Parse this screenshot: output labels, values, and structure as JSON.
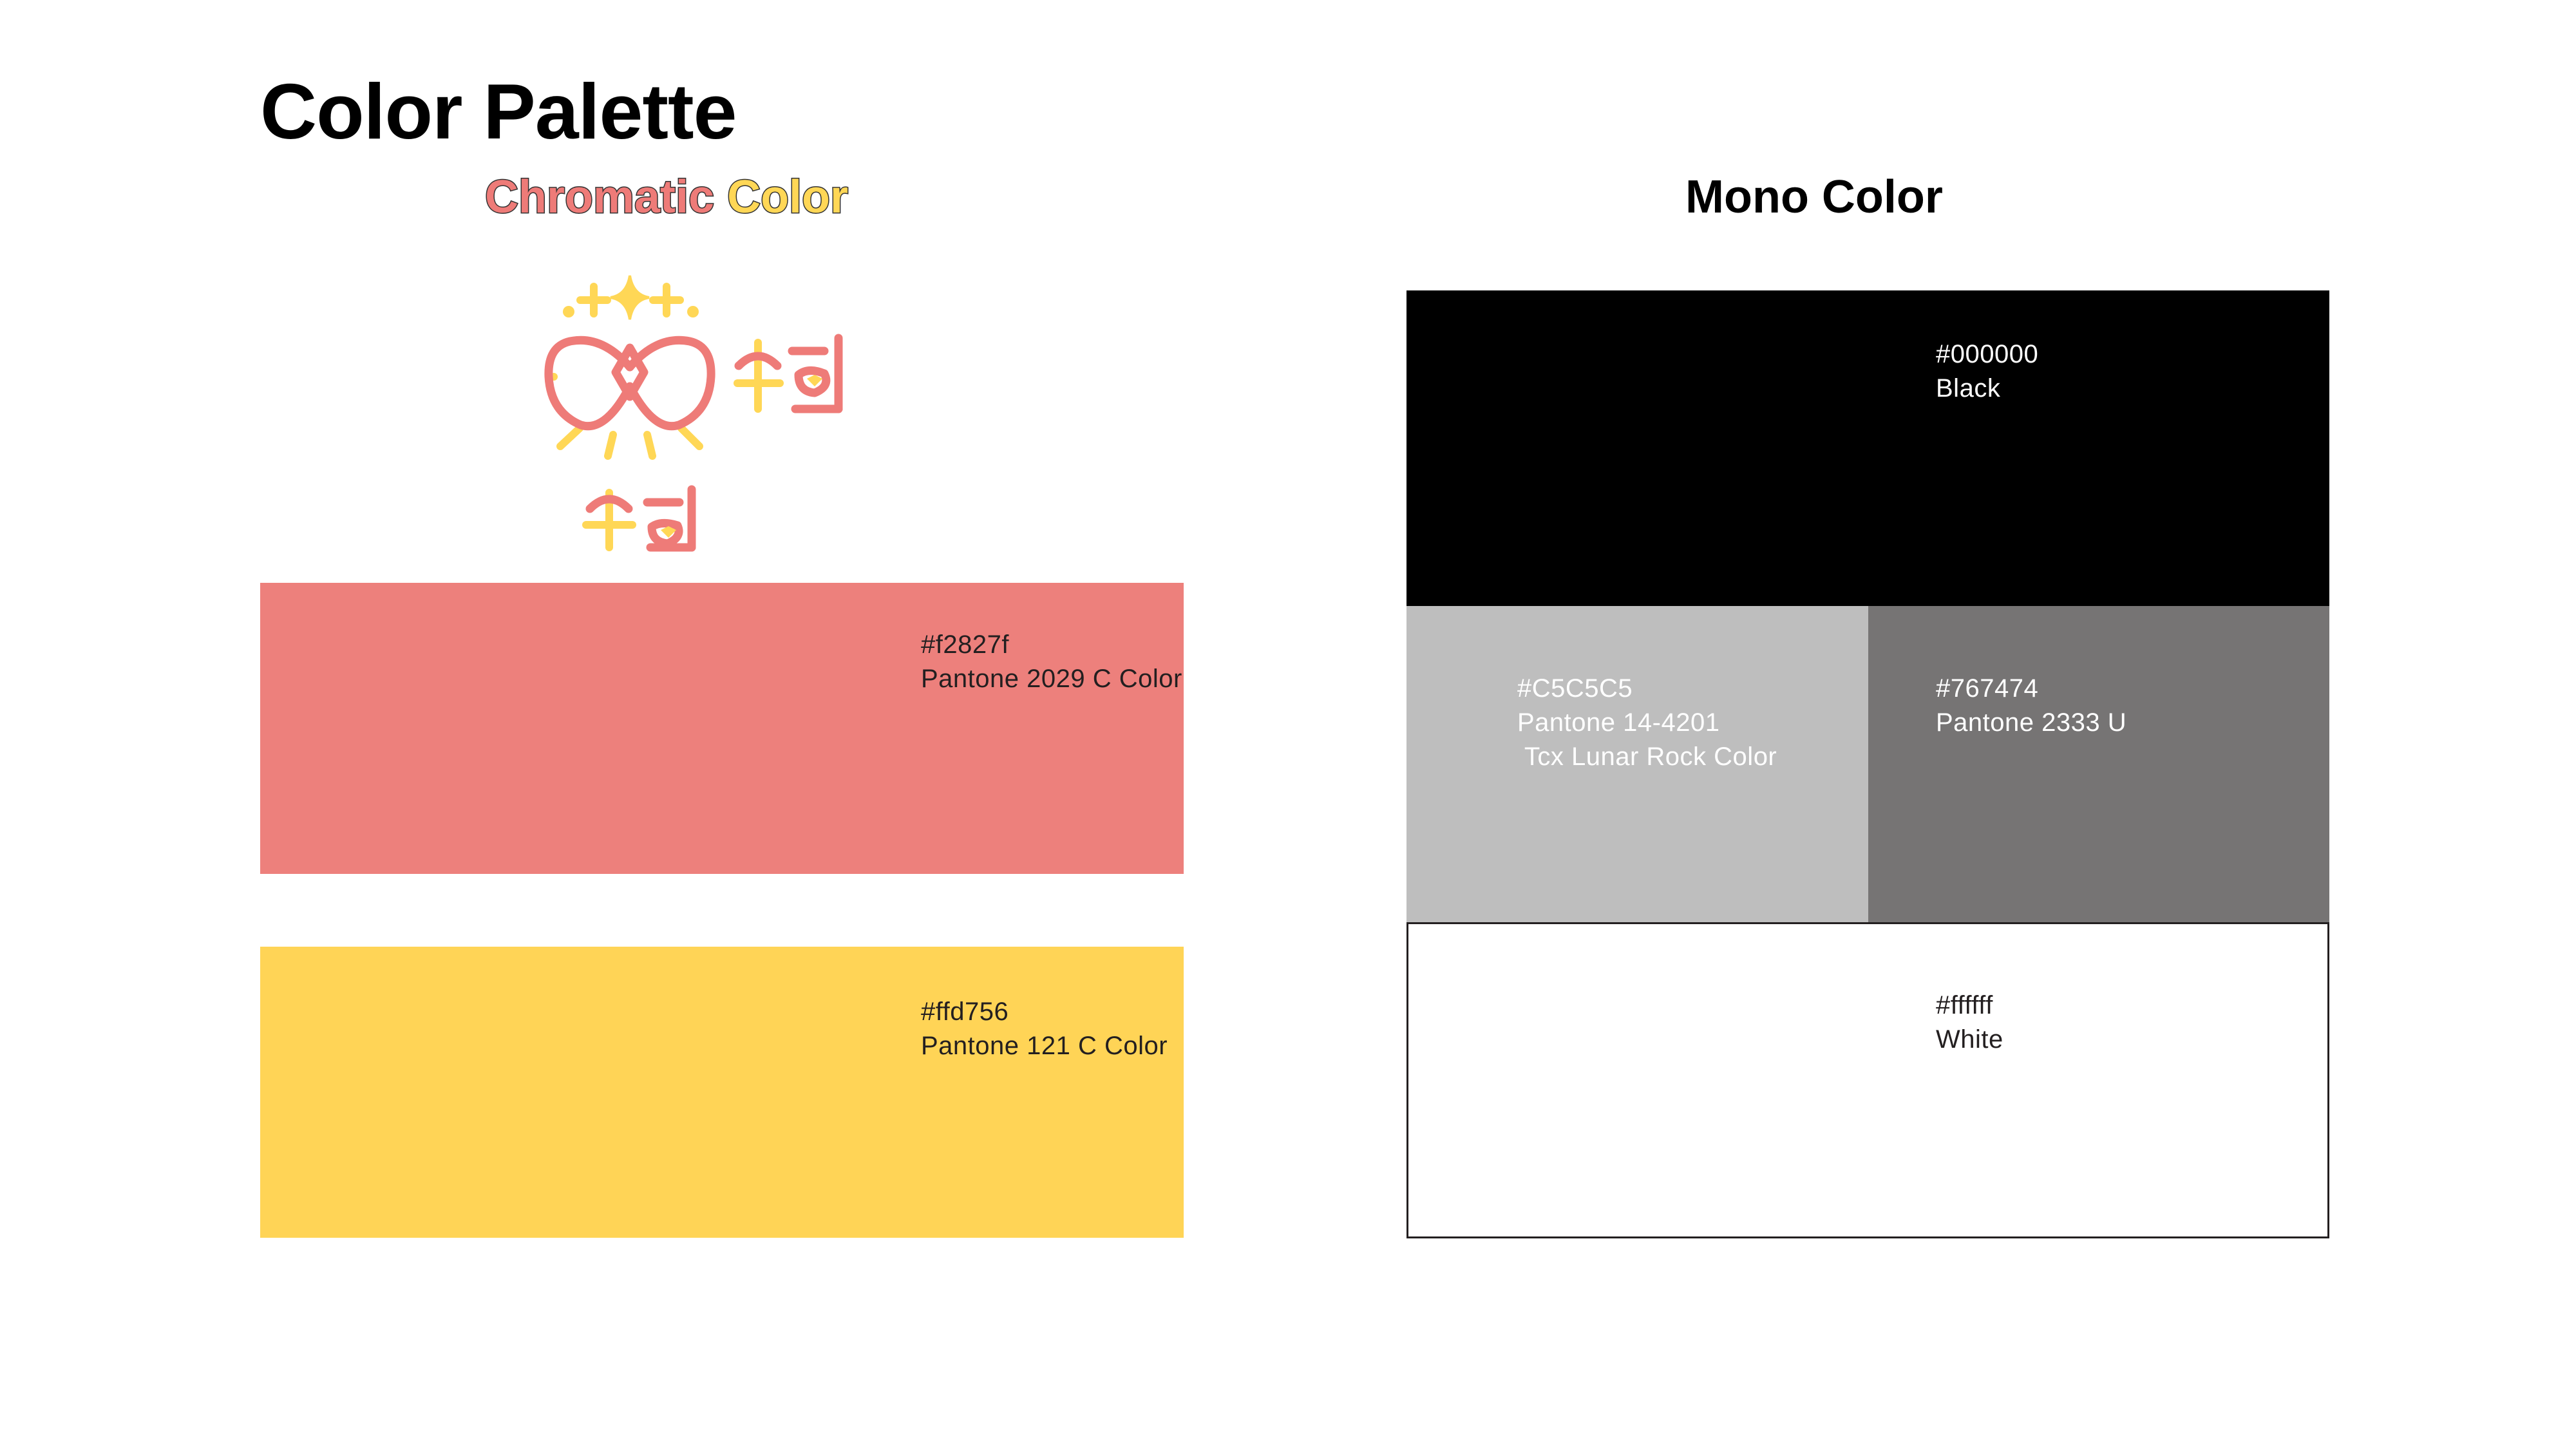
{
  "title": "Color Palette",
  "chromatic": {
    "heading_part1": "Chromatic",
    "heading_part2": "Color",
    "heading_part1_color": "#ee7b78",
    "heading_part2_color": "#ffd756",
    "logo": {
      "icon": "ribbon-sparkle-logo",
      "line1": "수희",
      "line2": "수희",
      "colors": [
        "#ee7b78",
        "#ffd756"
      ]
    },
    "swatches": [
      {
        "hex": "#f2827f",
        "name": "Pantone 2029 C Color",
        "fill": "#ed807c",
        "text_color": "#231f20"
      },
      {
        "hex": "#ffd756",
        "name": "Pantone 121 C Color",
        "fill": "#ffd456",
        "text_color": "#231f20"
      }
    ]
  },
  "mono": {
    "heading": "Mono Color",
    "swatches": [
      {
        "hex": "#000000",
        "name": "Black",
        "fill": "#000000",
        "text_color": "#ffffff"
      },
      {
        "hex": "#C5C5C5",
        "name": "Pantone 14-4201\n Tcx Lunar Rock Color",
        "fill": "#bebebe",
        "text_color": "#ffffff"
      },
      {
        "hex": "#767474",
        "name": "Pantone 2333 U",
        "fill": "#767474",
        "text_color": "#ffffff"
      },
      {
        "hex": "#ffffff",
        "name": "White",
        "fill": "#ffffff",
        "text_color": "#231f20"
      }
    ]
  }
}
